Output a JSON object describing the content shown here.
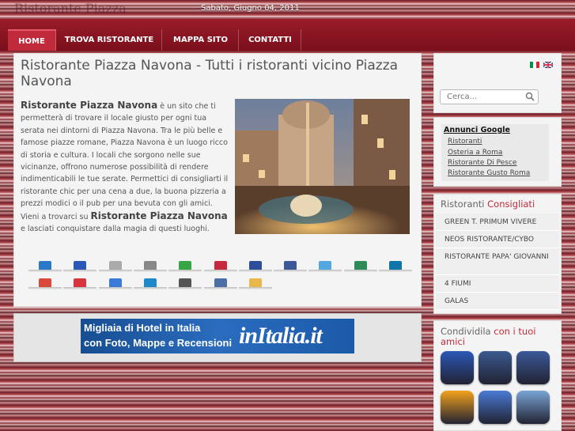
{
  "header": {
    "logo_text": "Ristorante Piazza",
    "date": "Sabato, Giugno 04, 2011"
  },
  "nav": [
    {
      "label": "HOME",
      "active": true
    },
    {
      "label": "TROVA RISTORANTE",
      "active": false
    },
    {
      "label": "MAPPA SITO",
      "active": false
    },
    {
      "label": "CONTATTI",
      "active": false
    }
  ],
  "main": {
    "title": "Ristorante Piazza Navona - Tutti i ristoranti vicino Piazza Navona",
    "intro_bold": "Ristorante Piazza Navona",
    "intro_text": " è un sito che ti permetterà di trovare il locale giusto per ogni tua serata nei dintorni di Piazza Navona. Tra le più belle e famose piazze romane, Piazza Navona è un luogo ricco di storia e cultura. I locali che sorgono nelle sue vicinanze, offrono numerose possibilità di rendere indimenticabili le tue serate. Permettici di consigliarti il ristorante chic per una cena a due, la buona pizzeria a prezzi modici o il pub per una bevuta con gli amici.",
    "outro_pre": "Vieni a trovarci su ",
    "outro_bold": "Ristorante Piazza Navona",
    "outro_post": " e lasciati conquistare dalla magia di questi luoghi."
  },
  "social_icons": [
    {
      "name": "digg-icon",
      "color": "#2a78c8"
    },
    {
      "name": "delicious-icon",
      "color": "#2b58b8"
    },
    {
      "name": "email-icon",
      "color": "#aaaaaa"
    },
    {
      "name": "print-icon",
      "color": "#888888"
    },
    {
      "name": "stumbleupon-icon",
      "color": "#37a545"
    },
    {
      "name": "mixx-icon",
      "color": "#c8283c"
    },
    {
      "name": "myspace-icon",
      "color": "#2d4e9a"
    },
    {
      "name": "facebook-icon",
      "color": "#3b5998"
    },
    {
      "name": "twitter-icon",
      "color": "#52a8e0"
    },
    {
      "name": "yahoo-buzz-icon",
      "color": "#2e8b57"
    },
    {
      "name": "linkedin-icon",
      "color": "#0e76a8"
    },
    {
      "name": "google-icon",
      "color": "#d9483b"
    },
    {
      "name": "technorati-icon",
      "color": "#d8343e"
    },
    {
      "name": "friendfeed-icon",
      "color": "#3a7bd5"
    },
    {
      "name": "live-icon",
      "color": "#1e88c8"
    },
    {
      "name": "newsvine-icon",
      "color": "#555555"
    },
    {
      "name": "blogger-icon",
      "color": "#4a6fa5"
    },
    {
      "name": "bookmark-icon",
      "color": "#e8b84a"
    }
  ],
  "banner": {
    "line1": "Migliaia di Hotel in Italia",
    "line2": "con Foto, Mappe e Recensioni",
    "brand_prefix": "in",
    "brand": "Italia.it"
  },
  "sidebar": {
    "search_placeholder": "Cerca...",
    "ads_title": "Annunci Google",
    "ads_links": [
      "Ristoranti",
      "Osteria a Roma",
      "Ristorante Di Pesce",
      "Ristorante Gusto Roma"
    ],
    "recommended_title_plain": "Ristoranti ",
    "recommended_title_accent": "Consigliati",
    "recommended": [
      "GREEN T. PRIMUM VIVERE",
      "NEOS RISTORANTE/CYBO",
      "RISTORANTE PAPA' GIOVANNI",
      "4 FIUMI",
      "GALAS"
    ],
    "share_title_plain": "Condividila ",
    "share_title_accent": "con i tuoi amici",
    "share_icons": [
      {
        "name": "delicious-share-icon",
        "color": "#2b58b8"
      },
      {
        "name": "myspace-share-icon",
        "color": "#3a5a90"
      },
      {
        "name": "facebook-share-icon",
        "color": "#3b5998"
      },
      {
        "name": "fark-share-icon",
        "color": "#f2a21c"
      },
      {
        "name": "google-share-icon",
        "color": "#4a7bd6"
      },
      {
        "name": "reddit-share-icon",
        "color": "#7aa5d6"
      }
    ]
  },
  "colors": {
    "nav_bg": "#8a1522",
    "nav_active": "#c12a3a",
    "accent": "#c12a3a"
  }
}
